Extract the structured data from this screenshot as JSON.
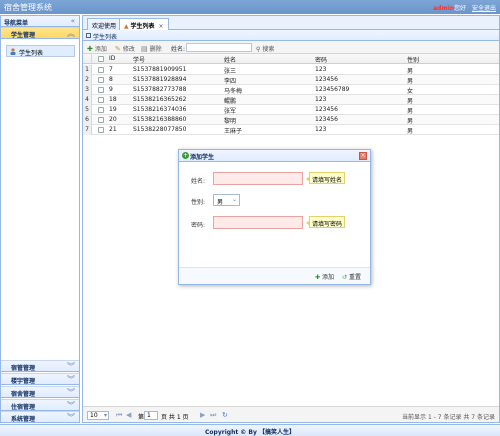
{
  "app": {
    "title": "宿舍管理系统"
  },
  "header": {
    "user": "admin",
    "greeting": "您好",
    "logout": "安全退出"
  },
  "nav": {
    "title": "导航菜单",
    "collapse_icon": "double-chevron-left-icon",
    "sections": [
      {
        "label": "学生管理",
        "selected": true,
        "items": [
          {
            "label": "学生列表"
          }
        ]
      },
      {
        "label": "宿管管理"
      },
      {
        "label": "楼宇管理"
      },
      {
        "label": "宿舍管理"
      },
      {
        "label": "住宿管理"
      },
      {
        "label": "系统管理"
      }
    ]
  },
  "tabs": [
    {
      "label": "欢迎使用",
      "active": false
    },
    {
      "label": "学生列表",
      "active": true,
      "close": "×"
    }
  ],
  "grid": {
    "title": "学生列表",
    "toolbar": {
      "add": "添加",
      "edit": "修改",
      "delete": "删除",
      "search_label": "姓名:",
      "search_button": "搜索"
    },
    "columns": [
      "ID",
      "学号",
      "姓名",
      "密码",
      "性别"
    ],
    "rows": [
      {
        "n": "1",
        "id": "7",
        "sno": "S1537881909951",
        "name": "张三",
        "pwd": "123",
        "sex": "男"
      },
      {
        "n": "2",
        "id": "8",
        "sno": "S1537881928894",
        "name": "李四",
        "pwd": "123456",
        "sex": "男"
      },
      {
        "n": "3",
        "id": "9",
        "sno": "S1537882773788",
        "name": "马冬梅",
        "pwd": "123456789",
        "sex": "女"
      },
      {
        "n": "4",
        "id": "18",
        "sno": "S1538216365262",
        "name": "鲲鹏",
        "pwd": "123",
        "sex": "男"
      },
      {
        "n": "5",
        "id": "19",
        "sno": "S1538216374036",
        "name": "张军",
        "pwd": "123456",
        "sex": "男"
      },
      {
        "n": "6",
        "id": "20",
        "sno": "S1538216388860",
        "name": "黎明",
        "pwd": "123456",
        "sex": "男"
      },
      {
        "n": "7",
        "id": "21",
        "sno": "S1538228077850",
        "name": "王麻子",
        "pwd": "123",
        "sex": "男"
      }
    ]
  },
  "pager": {
    "page_size": "10",
    "page": "1",
    "page_prefix": "第",
    "page_suffix": "页 共 1 页",
    "info": "当前显示 1 - 7 条记录 共 7 条记录"
  },
  "dialog": {
    "title": "添加学生",
    "name_label": "姓名:",
    "name_tip": "请填写姓名",
    "gender_label": "性别:",
    "gender_value": "男",
    "password_label": "密码:",
    "password_tip": "请填写密码",
    "add_button": "添加",
    "reset_button": "重置"
  },
  "footer": {
    "text": "Copyright © By 【搞笑人生】"
  }
}
